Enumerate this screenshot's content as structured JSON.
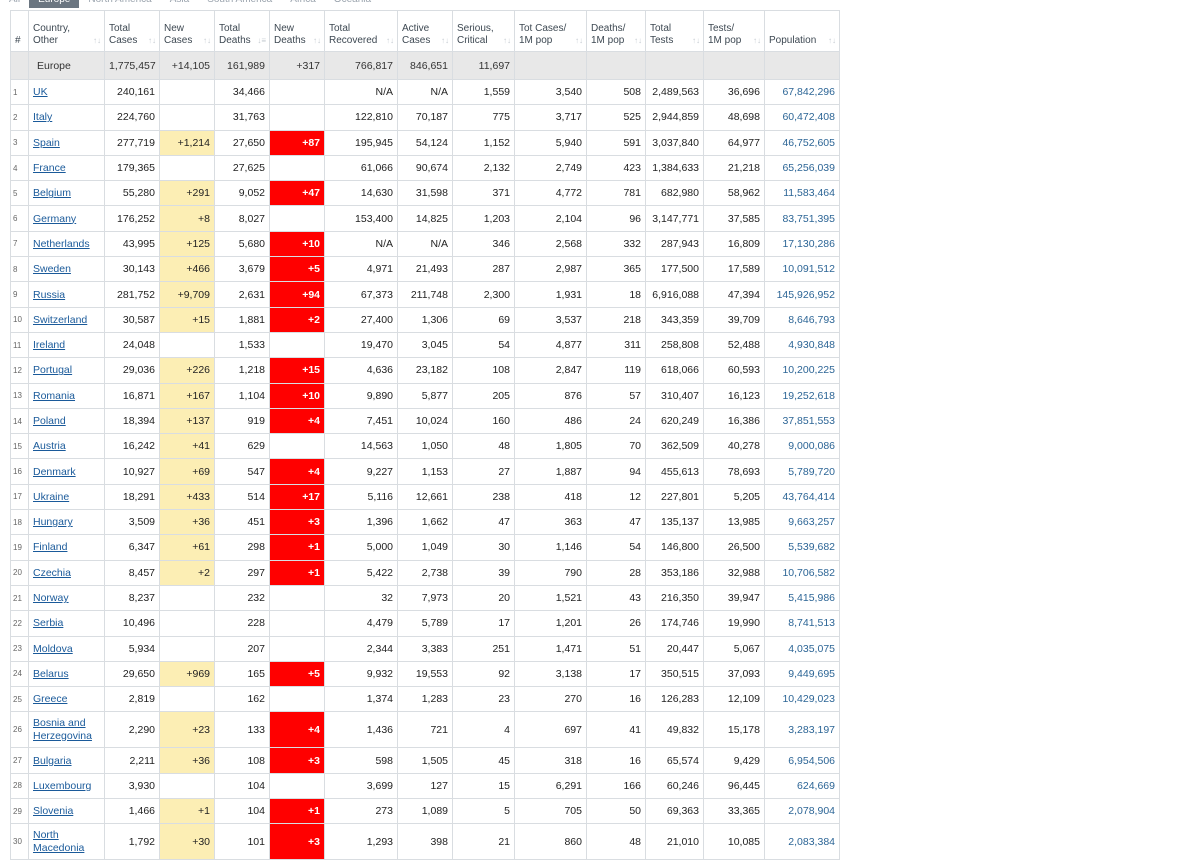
{
  "tabs": [
    "All",
    "Europe",
    "North America",
    "Asia",
    "South America",
    "Africa",
    "Oceania"
  ],
  "active_tab": "Europe",
  "columns": [
    {
      "key": "idx",
      "l1": "#",
      "l2": ""
    },
    {
      "key": "country",
      "l1": "Country,",
      "l2": "Other"
    },
    {
      "key": "total_cases",
      "l1": "Total",
      "l2": "Cases"
    },
    {
      "key": "new_cases",
      "l1": "New",
      "l2": "Cases"
    },
    {
      "key": "total_deaths",
      "l1": "Total",
      "l2": "Deaths"
    },
    {
      "key": "new_deaths",
      "l1": "New",
      "l2": "Deaths"
    },
    {
      "key": "total_recovered",
      "l1": "Total",
      "l2": "Recovered"
    },
    {
      "key": "active_cases",
      "l1": "Active",
      "l2": "Cases"
    },
    {
      "key": "serious_critical",
      "l1": "Serious,",
      "l2": "Critical"
    },
    {
      "key": "tot_cases_1m",
      "l1": "Tot Cases/",
      "l2": "1M pop"
    },
    {
      "key": "deaths_1m",
      "l1": "Deaths/",
      "l2": "1M pop"
    },
    {
      "key": "total_tests",
      "l1": "Total",
      "l2": "Tests"
    },
    {
      "key": "tests_1m",
      "l1": "Tests/",
      "l2": "1M pop"
    },
    {
      "key": "population",
      "l1": "Population",
      "l2": ""
    }
  ],
  "sorted_column": "total_deaths",
  "summary": [
    "Europe",
    "1,775,457",
    "+14,105",
    "161,989",
    "+317",
    "766,817",
    "846,651",
    "11,697",
    "",
    "",
    "",
    "",
    ""
  ],
  "rows": [
    [
      "1",
      "UK",
      "240,161",
      "",
      "34,466",
      "",
      "N/A",
      "N/A",
      "1,559",
      "3,540",
      "508",
      "2,489,563",
      "36,696",
      "67,842,296"
    ],
    [
      "2",
      "Italy",
      "224,760",
      "",
      "31,763",
      "",
      "122,810",
      "70,187",
      "775",
      "3,717",
      "525",
      "2,944,859",
      "48,698",
      "60,472,408"
    ],
    [
      "3",
      "Spain",
      "277,719",
      "+1,214",
      "27,650",
      "+87",
      "195,945",
      "54,124",
      "1,152",
      "5,940",
      "591",
      "3,037,840",
      "64,977",
      "46,752,605"
    ],
    [
      "4",
      "France",
      "179,365",
      "",
      "27,625",
      "",
      "61,066",
      "90,674",
      "2,132",
      "2,749",
      "423",
      "1,384,633",
      "21,218",
      "65,256,039"
    ],
    [
      "5",
      "Belgium",
      "55,280",
      "+291",
      "9,052",
      "+47",
      "14,630",
      "31,598",
      "371",
      "4,772",
      "781",
      "682,980",
      "58,962",
      "11,583,464"
    ],
    [
      "6",
      "Germany",
      "176,252",
      "+8",
      "8,027",
      "",
      "153,400",
      "14,825",
      "1,203",
      "2,104",
      "96",
      "3,147,771",
      "37,585",
      "83,751,395"
    ],
    [
      "7",
      "Netherlands",
      "43,995",
      "+125",
      "5,680",
      "+10",
      "N/A",
      "N/A",
      "346",
      "2,568",
      "332",
      "287,943",
      "16,809",
      "17,130,286"
    ],
    [
      "8",
      "Sweden",
      "30,143",
      "+466",
      "3,679",
      "+5",
      "4,971",
      "21,493",
      "287",
      "2,987",
      "365",
      "177,500",
      "17,589",
      "10,091,512"
    ],
    [
      "9",
      "Russia",
      "281,752",
      "+9,709",
      "2,631",
      "+94",
      "67,373",
      "211,748",
      "2,300",
      "1,931",
      "18",
      "6,916,088",
      "47,394",
      "145,926,952"
    ],
    [
      "10",
      "Switzerland",
      "30,587",
      "+15",
      "1,881",
      "+2",
      "27,400",
      "1,306",
      "69",
      "3,537",
      "218",
      "343,359",
      "39,709",
      "8,646,793"
    ],
    [
      "11",
      "Ireland",
      "24,048",
      "",
      "1,533",
      "",
      "19,470",
      "3,045",
      "54",
      "4,877",
      "311",
      "258,808",
      "52,488",
      "4,930,848"
    ],
    [
      "12",
      "Portugal",
      "29,036",
      "+226",
      "1,218",
      "+15",
      "4,636",
      "23,182",
      "108",
      "2,847",
      "119",
      "618,066",
      "60,593",
      "10,200,225"
    ],
    [
      "13",
      "Romania",
      "16,871",
      "+167",
      "1,104",
      "+10",
      "9,890",
      "5,877",
      "205",
      "876",
      "57",
      "310,407",
      "16,123",
      "19,252,618"
    ],
    [
      "14",
      "Poland",
      "18,394",
      "+137",
      "919",
      "+4",
      "7,451",
      "10,024",
      "160",
      "486",
      "24",
      "620,249",
      "16,386",
      "37,851,553"
    ],
    [
      "15",
      "Austria",
      "16,242",
      "+41",
      "629",
      "",
      "14,563",
      "1,050",
      "48",
      "1,805",
      "70",
      "362,509",
      "40,278",
      "9,000,086"
    ],
    [
      "16",
      "Denmark",
      "10,927",
      "+69",
      "547",
      "+4",
      "9,227",
      "1,153",
      "27",
      "1,887",
      "94",
      "455,613",
      "78,693",
      "5,789,720"
    ],
    [
      "17",
      "Ukraine",
      "18,291",
      "+433",
      "514",
      "+17",
      "5,116",
      "12,661",
      "238",
      "418",
      "12",
      "227,801",
      "5,205",
      "43,764,414"
    ],
    [
      "18",
      "Hungary",
      "3,509",
      "+36",
      "451",
      "+3",
      "1,396",
      "1,662",
      "47",
      "363",
      "47",
      "135,137",
      "13,985",
      "9,663,257"
    ],
    [
      "19",
      "Finland",
      "6,347",
      "+61",
      "298",
      "+1",
      "5,000",
      "1,049",
      "30",
      "1,146",
      "54",
      "146,800",
      "26,500",
      "5,539,682"
    ],
    [
      "20",
      "Czechia",
      "8,457",
      "+2",
      "297",
      "+1",
      "5,422",
      "2,738",
      "39",
      "790",
      "28",
      "353,186",
      "32,988",
      "10,706,582"
    ],
    [
      "21",
      "Norway",
      "8,237",
      "",
      "232",
      "",
      "32",
      "7,973",
      "20",
      "1,521",
      "43",
      "216,350",
      "39,947",
      "5,415,986"
    ],
    [
      "22",
      "Serbia",
      "10,496",
      "",
      "228",
      "",
      "4,479",
      "5,789",
      "17",
      "1,201",
      "26",
      "174,746",
      "19,990",
      "8,741,513"
    ],
    [
      "23",
      "Moldova",
      "5,934",
      "",
      "207",
      "",
      "2,344",
      "3,383",
      "251",
      "1,471",
      "51",
      "20,447",
      "5,067",
      "4,035,075"
    ],
    [
      "24",
      "Belarus",
      "29,650",
      "+969",
      "165",
      "+5",
      "9,932",
      "19,553",
      "92",
      "3,138",
      "17",
      "350,515",
      "37,093",
      "9,449,695"
    ],
    [
      "25",
      "Greece",
      "2,819",
      "",
      "162",
      "",
      "1,374",
      "1,283",
      "23",
      "270",
      "16",
      "126,283",
      "12,109",
      "10,429,023"
    ],
    [
      "26",
      "Bosnia and Herzegovina",
      "2,290",
      "+23",
      "133",
      "+4",
      "1,436",
      "721",
      "4",
      "697",
      "41",
      "49,832",
      "15,178",
      "3,283,197"
    ],
    [
      "27",
      "Bulgaria",
      "2,211",
      "+36",
      "108",
      "+3",
      "598",
      "1,505",
      "45",
      "318",
      "16",
      "65,574",
      "9,429",
      "6,954,506"
    ],
    [
      "28",
      "Luxembourg",
      "3,930",
      "",
      "104",
      "",
      "3,699",
      "127",
      "15",
      "6,291",
      "166",
      "60,246",
      "96,445",
      "624,669"
    ],
    [
      "29",
      "Slovenia",
      "1,466",
      "+1",
      "104",
      "+1",
      "273",
      "1,089",
      "5",
      "705",
      "50",
      "69,363",
      "33,365",
      "2,078,904"
    ],
    [
      "30",
      "North Macedonia",
      "1,792",
      "+30",
      "101",
      "+3",
      "1,293",
      "398",
      "21",
      "860",
      "48",
      "21,010",
      "10,085",
      "2,083,384"
    ]
  ]
}
